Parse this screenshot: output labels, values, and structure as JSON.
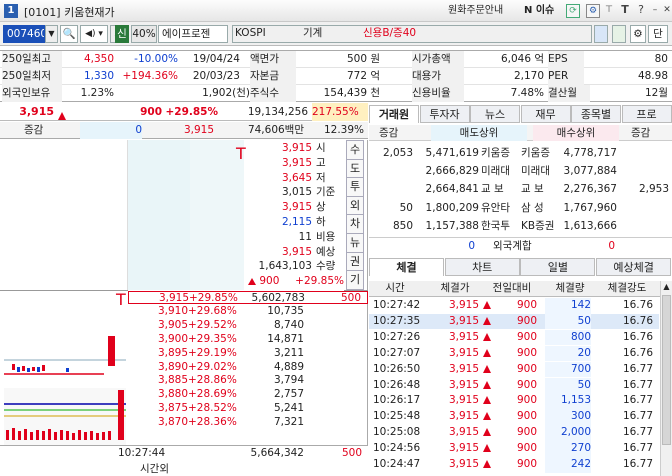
{
  "title_bar": {
    "window_num": "1",
    "title": "[0101] 키움현재가",
    "order_guide": "원화주문안내",
    "n_issue": "N 이슈"
  },
  "toolbar": {
    "code": "007460",
    "shin": "신",
    "margin": "40%",
    "stock_name": "에이프로젠 ",
    "market": "KOSPI",
    "sector": "기계",
    "credit": "신용B/증40",
    "last_btn": "단"
  },
  "info": {
    "rows": [
      {
        "l1": "250일최고",
        "v1": "4,350",
        "p1": "-10.00%",
        "d1": "19/04/24",
        "l2": "액면가",
        "v2": "500 원",
        "l3": "시가총액",
        "v3": "6,046 억",
        "l4": "EPS",
        "v4": "80"
      },
      {
        "l1": "250일최저",
        "v1": "1,330",
        "p1": "+194.36%",
        "d1": "20/03/23",
        "l2": "자본금",
        "v2": "772 억",
        "l3": "대용가",
        "v3": "2,170",
        "l4": "PER",
        "v4": "48.98"
      },
      {
        "l1": "외국인보유",
        "v1": "1.23%",
        "p1": "",
        "d1": "1,902(천)",
        "l2": "주식수",
        "v2": "154,439 천",
        "l3": "신용비율",
        "v3": "7.48%",
        "l4": "결산월",
        "v4": "12월"
      }
    ]
  },
  "price": {
    "current": "3,915",
    "change": "900",
    "rate": "+29.85%",
    "volume": "19,134,256",
    "vol_rate": "217.55%"
  },
  "diff": {
    "label": "증감",
    "v1": "0",
    "v2": "3,915",
    "amount": "74,606백만",
    "ratio": "12.39%"
  },
  "summary": [
    {
      "v": "3,915",
      "k": "시"
    },
    {
      "v": "3,915",
      "k": "고"
    },
    {
      "v": "3,645",
      "k": "저"
    },
    {
      "v": "3,015",
      "k": "기준"
    },
    {
      "v": "3,915",
      "k": "상"
    },
    {
      "v": "2,115",
      "k": "하"
    },
    {
      "v": "11",
      "k": "비용"
    },
    {
      "v": "3,915",
      "k": "예상"
    },
    {
      "v": "1,643,103",
      "k": "수량"
    }
  ],
  "summary_tail": {
    "chg": "900",
    "rate": "+29.85%"
  },
  "side_tabs": [
    "수",
    "도",
    "투",
    "외",
    "차",
    "뉴",
    "권",
    "기"
  ],
  "quotes": [
    {
      "price": "3,915",
      "rate": "+29.85%",
      "vol": "5,602,783",
      "extra": "500"
    },
    {
      "price": "3,910",
      "rate": "+29.68%",
      "vol": "10,735",
      "extra": ""
    },
    {
      "price": "3,905",
      "rate": "+29.52%",
      "vol": "8,740",
      "extra": ""
    },
    {
      "price": "3,900",
      "rate": "+29.35%",
      "vol": "14,871",
      "extra": ""
    },
    {
      "price": "3,895",
      "rate": "+29.19%",
      "vol": "3,211",
      "extra": ""
    },
    {
      "price": "3,890",
      "rate": "+29.02%",
      "vol": "4,889",
      "extra": ""
    },
    {
      "price": "3,885",
      "rate": "+28.86%",
      "vol": "3,794",
      "extra": ""
    },
    {
      "price": "3,880",
      "rate": "+28.69%",
      "vol": "2,757",
      "extra": ""
    },
    {
      "price": "3,875",
      "rate": "+28.52%",
      "vol": "5,241",
      "extra": ""
    },
    {
      "price": "3,870",
      "rate": "+28.36%",
      "vol": "7,321",
      "extra": ""
    }
  ],
  "bottom": {
    "time": "10:27:44",
    "time_label": "시간외",
    "total": "5,664,342",
    "extra": "500"
  },
  "right_tabs": [
    "거래원",
    "투자자",
    "뉴스",
    "재무",
    "종목별",
    "프로"
  ],
  "broker_header": {
    "diff": "증감",
    "sell": "매도상위",
    "buy": "매수상위",
    "diff2": "증감"
  },
  "brokers": [
    {
      "d1": "2,053",
      "sv": "5,471,619",
      "sn": "키움증",
      "bn": "키움증",
      "bv": "4,778,717",
      "d2": ""
    },
    {
      "d1": "",
      "sv": "2,666,829",
      "sn": "미래대",
      "bn": "미래대",
      "bv": "3,077,884",
      "d2": ""
    },
    {
      "d1": "",
      "sv": "2,664,841",
      "sn": "교 보",
      "bn": "교 보",
      "bv": "2,276,367",
      "d2": "2,953"
    },
    {
      "d1": "50",
      "sv": "1,800,209",
      "sn": "유안타",
      "bn": "삼 성",
      "bv": "1,767,960",
      "d2": ""
    },
    {
      "d1": "850",
      "sv": "1,157,388",
      "sn": "한국투",
      "bn": "KB증권",
      "bv": "1,613,666",
      "d2": ""
    }
  ],
  "foreign": {
    "v1": "0",
    "label": "외국계합",
    "v2": "0"
  },
  "trade_tabs": [
    "체결",
    "차트",
    "일별",
    "예상체결"
  ],
  "trade_header": {
    "time": "시간",
    "price": "체결가",
    "chg": "전일대비",
    "qty": "체결량",
    "str": "체결강도"
  },
  "trades": [
    {
      "time": "10:27:42",
      "price": "3,915",
      "chg": "900",
      "qty": "142",
      "str": "16.76"
    },
    {
      "time": "10:27:35",
      "price": "3,915",
      "chg": "900",
      "qty": "50",
      "str": "16.76"
    },
    {
      "time": "10:27:26",
      "price": "3,915",
      "chg": "900",
      "qty": "800",
      "str": "16.76"
    },
    {
      "time": "10:27:07",
      "price": "3,915",
      "chg": "900",
      "qty": "20",
      "str": "16.76"
    },
    {
      "time": "10:26:50",
      "price": "3,915",
      "chg": "900",
      "qty": "700",
      "str": "16.77"
    },
    {
      "time": "10:26:48",
      "price": "3,915",
      "chg": "900",
      "qty": "50",
      "str": "16.77"
    },
    {
      "time": "10:26:17",
      "price": "3,915",
      "chg": "900",
      "qty": "1,153",
      "str": "16.77"
    },
    {
      "time": "10:25:48",
      "price": "3,915",
      "chg": "900",
      "qty": "300",
      "str": "16.77"
    },
    {
      "time": "10:25:08",
      "price": "3,915",
      "chg": "900",
      "qty": "2,000",
      "str": "16.77"
    },
    {
      "time": "10:24:56",
      "price": "3,915",
      "chg": "900",
      "qty": "270",
      "str": "16.77"
    },
    {
      "time": "10:24:47",
      "price": "3,915",
      "chg": "900",
      "qty": "242",
      "str": "16.77"
    }
  ],
  "colors": {
    "up": "#e0001b",
    "down": "#1040d0",
    "accent": "#2a5fb0"
  }
}
